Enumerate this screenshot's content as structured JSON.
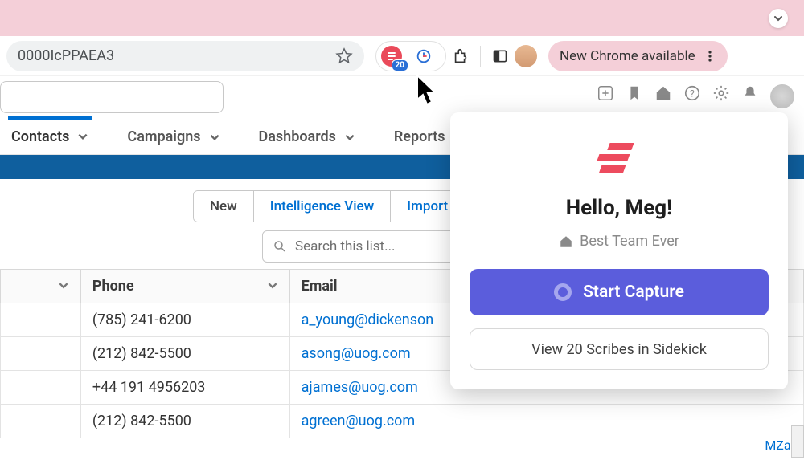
{
  "banner": {
    "expand_icon": "chevron-down"
  },
  "browser": {
    "url_fragment": "0000IcPPAEA3",
    "star_icon": "star",
    "scribe_badge": "20",
    "new_chrome": "New Chrome available"
  },
  "tabs": [
    {
      "label": "Contacts",
      "active": true
    },
    {
      "label": "Campaigns",
      "active": false
    },
    {
      "label": "Dashboards",
      "active": false
    },
    {
      "label": "Reports",
      "active": false
    }
  ],
  "actions": {
    "new": "New",
    "intel": "Intelligence View",
    "import": "Import"
  },
  "list_search_placeholder": "Search this list...",
  "columns": {
    "c0": "",
    "c1": "Phone",
    "c2": "Email"
  },
  "rows": [
    {
      "phone": "(785) 241-6200",
      "email": "a_young@dickenson"
    },
    {
      "phone": "(212) 842-5500",
      "email": "asong@uog.com"
    },
    {
      "phone": "+44 191 4956203",
      "email": "ajames@uog.com"
    },
    {
      "phone": "(212) 842-5500",
      "email": "agreen@uog.com"
    }
  ],
  "popup": {
    "greeting": "Hello, Meg!",
    "team": "Best Team Ever",
    "start": "Start Capture",
    "view": "View 20 Scribes in Sidekick"
  },
  "side_link": "MZabr"
}
